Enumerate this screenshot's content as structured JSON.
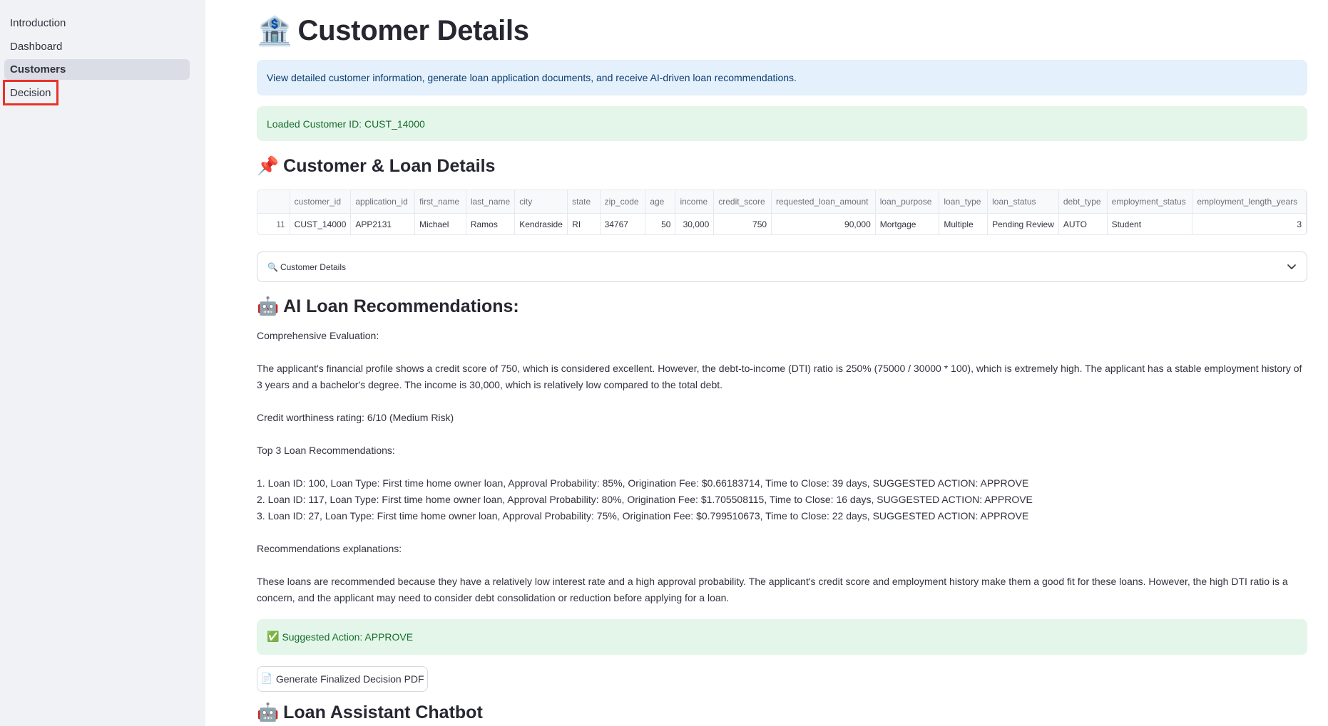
{
  "sidebar": {
    "items": [
      {
        "label": "Introduction"
      },
      {
        "label": "Dashboard"
      },
      {
        "label": "Customers"
      },
      {
        "label": "Decision"
      }
    ]
  },
  "header": {
    "icon": "🏦",
    "title": "Customer Details"
  },
  "info_message": "View detailed customer information, generate loan application documents, and receive AI-driven loan recommendations.",
  "loaded_message": "Loaded Customer ID: CUST_14000",
  "customer_section": {
    "icon": "📌",
    "title": "Customer & Loan Details"
  },
  "table": {
    "columns": [
      "",
      "customer_id",
      "application_id",
      "first_name",
      "last_name",
      "city",
      "state",
      "zip_code",
      "age",
      "income",
      "credit_score",
      "requested_loan_amount",
      "loan_purpose",
      "loan_type",
      "loan_status",
      "debt_type",
      "employment_status",
      "employment_length_years"
    ],
    "rows": [
      [
        "11",
        "CUST_14000",
        "APP2131",
        "Michael",
        "Ramos",
        "Kendraside",
        "RI",
        "34767",
        "50",
        "30,000",
        "750",
        "90,000",
        "Mortgage",
        "Multiple",
        "Pending Review",
        "AUTO",
        "Student",
        "3"
      ]
    ]
  },
  "expander": {
    "icon": "🔍",
    "label": "Customer Details"
  },
  "ai_section": {
    "icon": "🤖",
    "title": "AI Loan Recommendations:"
  },
  "ai_text": {
    "eval_heading": "Comprehensive Evaluation:",
    "eval_body": "The applicant's financial profile shows a credit score of 750, which is considered excellent. However, the debt-to-income (DTI) ratio is 250% (75000 / 30000 * 100), which is extremely high. The applicant has a stable employment history of 3 years and a bachelor's degree. The income is 30,000, which is relatively low compared to the total debt.",
    "rating": "Credit worthiness rating: 6/10 (Medium Risk)",
    "recs_heading": "Top 3 Loan Recommendations:",
    "recs": [
      "1. Loan ID: 100, Loan Type: First time home owner loan, Approval Probability: 85%, Origination Fee: $0.66183714, Time to Close: 39 days, SUGGESTED ACTION: APPROVE",
      "2. Loan ID: 117, Loan Type: First time home owner loan, Approval Probability: 80%, Origination Fee: $1.705508115, Time to Close: 16 days, SUGGESTED ACTION: APPROVE",
      "3. Loan ID: 27, Loan Type: First time home owner loan, Approval Probability: 75%, Origination Fee: $0.799510673, Time to Close: 22 days, SUGGESTED ACTION: APPROVE"
    ],
    "expl_heading": "Recommendations explanations:",
    "expl_body": "These loans are recommended because they have a relatively low interest rate and a high approval probability. The applicant's credit score and employment history make them a good fit for these loans. However, the high DTI ratio is a concern, and the applicant may need to consider debt consolidation or reduction before applying for a loan."
  },
  "suggested_action": {
    "icon": "✅",
    "text": "Suggested Action: APPROVE"
  },
  "pdf_button": {
    "icon": "📄",
    "label": "Generate Finalized Decision PDF"
  },
  "chat_section": {
    "icon": "🤖",
    "title": "Loan Assistant Chatbot"
  },
  "colors": {
    "sidebar_bg": "#f0f2f6",
    "info_bg": "#e4f0fb",
    "success_bg": "#e4f6ea",
    "highlight_red": "#e8322a"
  }
}
